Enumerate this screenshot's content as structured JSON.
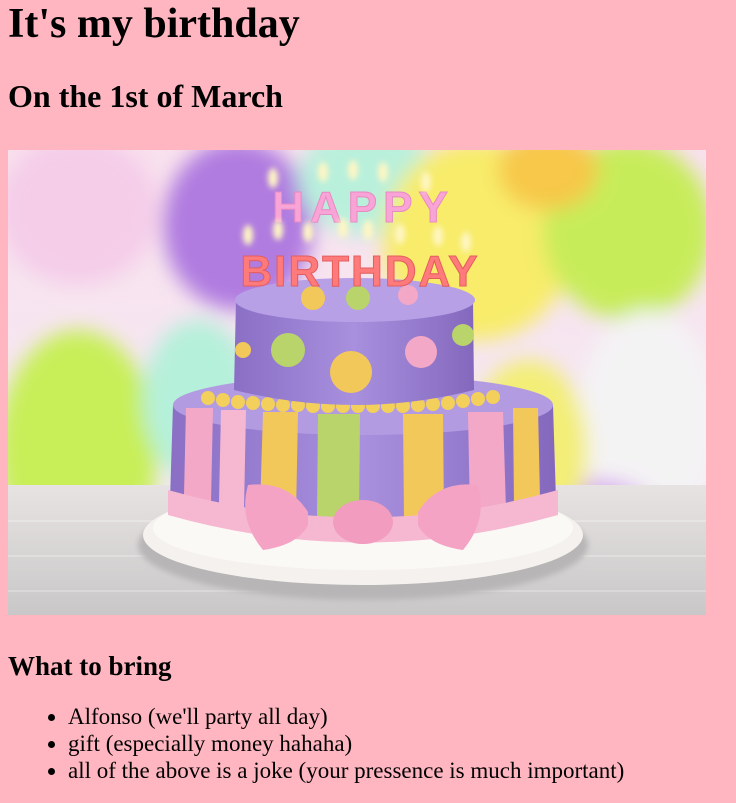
{
  "page": {
    "title": "It's my birthday",
    "subtitle": "On the 1st of March"
  },
  "hero_image": {
    "alt": "birthday cake with happy birthday candles",
    "candles_top": "HAPPY",
    "candles_bottom": "BIRTHDAY",
    "colors": {
      "cake_purple": "#a38ad8",
      "cake_purple_dark": "#8a6fc5",
      "stripe_yellow": "#f3c85b",
      "stripe_green": "#b9d46a",
      "stripe_pink": "#f4a8c8",
      "ribbon_pink": "#f6b8d0",
      "plate": "#f4f1ee"
    }
  },
  "bring": {
    "heading": "What to bring",
    "items": [
      "Alfonso (we'll party all day)",
      "gift (especially money hahaha)",
      "all of the above is a joke (your pressence is much important)"
    ]
  }
}
